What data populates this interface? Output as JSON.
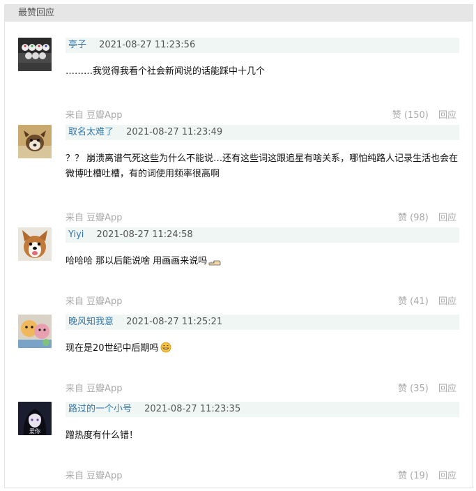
{
  "panel": {
    "title": "最赞回应"
  },
  "comments": [
    {
      "author": "亭子",
      "time": "2021-08-27 11:23:56",
      "content": "………我觉得我看个社会新闻说的话能踩中十几个",
      "source_label": "来自",
      "source_app": "豆瓣App",
      "like_label": "赞",
      "likes": "(150)",
      "reply_label": "回应",
      "avatar_icon": "avatar-bowling-pins"
    },
    {
      "author": "取名太难了",
      "time": "2021-08-27 11:23:49",
      "content": "？？ 崩溃离谱气死这些为什么不能说…还有这些词这跟追星有啥关系，哪怕纯路人记录生活也会在微博吐槽吐槽，有的词使用频率很高啊",
      "source_label": "来自",
      "source_app": "豆瓣App",
      "like_label": "赞",
      "likes": "(98)",
      "reply_label": "回应",
      "avatar_icon": "avatar-dog-photo"
    },
    {
      "author": "Yiyi",
      "time": "2021-08-27 11:24:58",
      "content": "哈哈哈 那以后能说啥 用画画来说吗",
      "source_label": "来自",
      "source_app": "豆瓣App",
      "like_label": "赞",
      "likes": "(41)",
      "reply_label": "回应",
      "avatar_icon": "avatar-corgi"
    },
    {
      "author": "晚风知我意",
      "time": "2021-08-27 11:25:21",
      "content": "现在是20世纪中后期吗",
      "source_label": "来自",
      "source_app": "豆瓣App",
      "like_label": "赞",
      "likes": "(35)",
      "reply_label": "回应",
      "avatar_icon": "avatar-plush-toys"
    },
    {
      "author": "路过的一个小号",
      "time": "2021-08-27 11:23:35",
      "content": "蹭热度有什么错！",
      "source_label": "来自",
      "source_app": "豆瓣App",
      "like_label": "赞",
      "likes": "(19)",
      "reply_label": "回应",
      "avatar_icon": "avatar-anime-girl",
      "avatar_text": "爱你"
    }
  ]
}
